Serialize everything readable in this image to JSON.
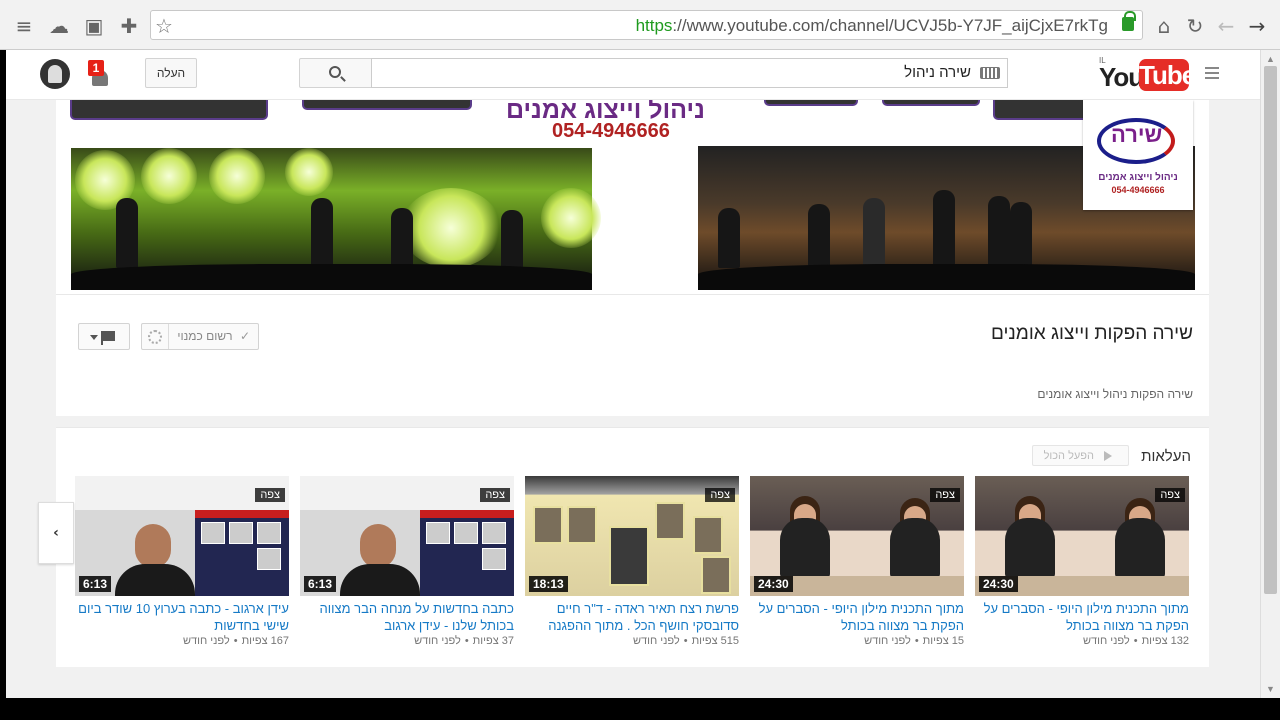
{
  "browser": {
    "url_scheme": "https",
    "url_rest": "://www.youtube.com/channel/UCVJ5b-Y7JF_aijCjxE7rkTg"
  },
  "header": {
    "notification_count": "1",
    "upload_label": "העלה",
    "search_value": "שירה ניהול",
    "logo_you": "You",
    "logo_tube": "Tube",
    "logo_region": "IL"
  },
  "banner": {
    "title": "ניהול וייצוג אמנים",
    "phone": "054-4946666",
    "logo_name": "שירה",
    "logo_tagline": "ניהול וייצוג אמנים",
    "logo_phone": "054-4946666"
  },
  "channel": {
    "title": "שירה הפקות וייצוג אומנים",
    "description": "שירה הפקות ניהול וייצוג אומנים",
    "subscribe_label": "רשום כמנוי"
  },
  "uploads": {
    "title": "העלאות",
    "play_all_label": "הפעל הכול",
    "videos": [
      {
        "duration": "24:30",
        "badge": "צפה",
        "title": "מתוך התכנית מילון היופי - הסברים על הפקת בר מצווה בכותל",
        "views": "132 צפיות",
        "age": "לפני חודש"
      },
      {
        "duration": "24:30",
        "badge": "צפה",
        "title": "מתוך התכנית מילון היופי - הסברים על הפקת בר מצווה בכותל",
        "views": "15 צפיות",
        "age": "לפני חודש"
      },
      {
        "duration": "18:13",
        "badge": "צפה",
        "title": "פרשת רצח תאיר ראדה - ד\"ר חיים סדובסקי חושף הכל . מתוך ההפגנה",
        "views": "515 צפיות",
        "age": "לפני חודש"
      },
      {
        "duration": "6:13",
        "badge": "צפה",
        "title": "כתבה בחדשות על מנחה הבר מצווה בכותל שלנו - עידן ארגוב",
        "views": "37 צפיות",
        "age": "לפני חודש"
      },
      {
        "duration": "6:13",
        "badge": "צפה",
        "title": "עידן ארגוב - כתבה בערוץ 10 שודר ביום שישי בחדשות",
        "views": "167 צפיות",
        "age": "לפני חודש"
      }
    ]
  }
}
